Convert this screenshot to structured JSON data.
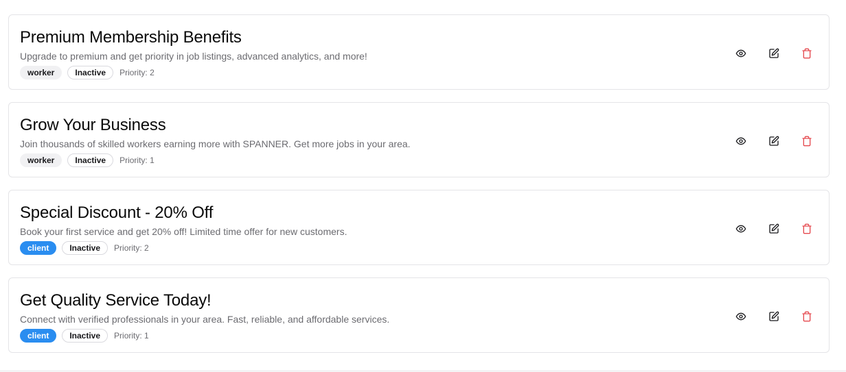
{
  "banners": [
    {
      "title": "Premium Membership Benefits",
      "description": "Upgrade to premium and get priority in job listings, advanced analytics, and more!",
      "role": "worker",
      "status": "Inactive",
      "priority": "Priority: 2"
    },
    {
      "title": "Grow Your Business",
      "description": "Join thousands of skilled workers earning more with SPANNER. Get more jobs in your area.",
      "role": "worker",
      "status": "Inactive",
      "priority": "Priority: 1"
    },
    {
      "title": "Special Discount - 20% Off",
      "description": "Book your first service and get 20% off! Limited time offer for new customers.",
      "role": "client",
      "status": "Inactive",
      "priority": "Priority: 2"
    },
    {
      "title": "Get Quality Service Today!",
      "description": "Connect with verified professionals in your area. Fast, reliable, and affordable services.",
      "role": "client",
      "status": "Inactive",
      "priority": "Priority: 1"
    }
  ],
  "actions": {
    "view_icon": "eye-icon",
    "edit_icon": "edit-icon",
    "delete_icon": "trash-icon"
  },
  "colors": {
    "client_badge": "#2a8df0",
    "worker_badge": "#f1f1f3",
    "delete_icon": "#e5484d"
  }
}
